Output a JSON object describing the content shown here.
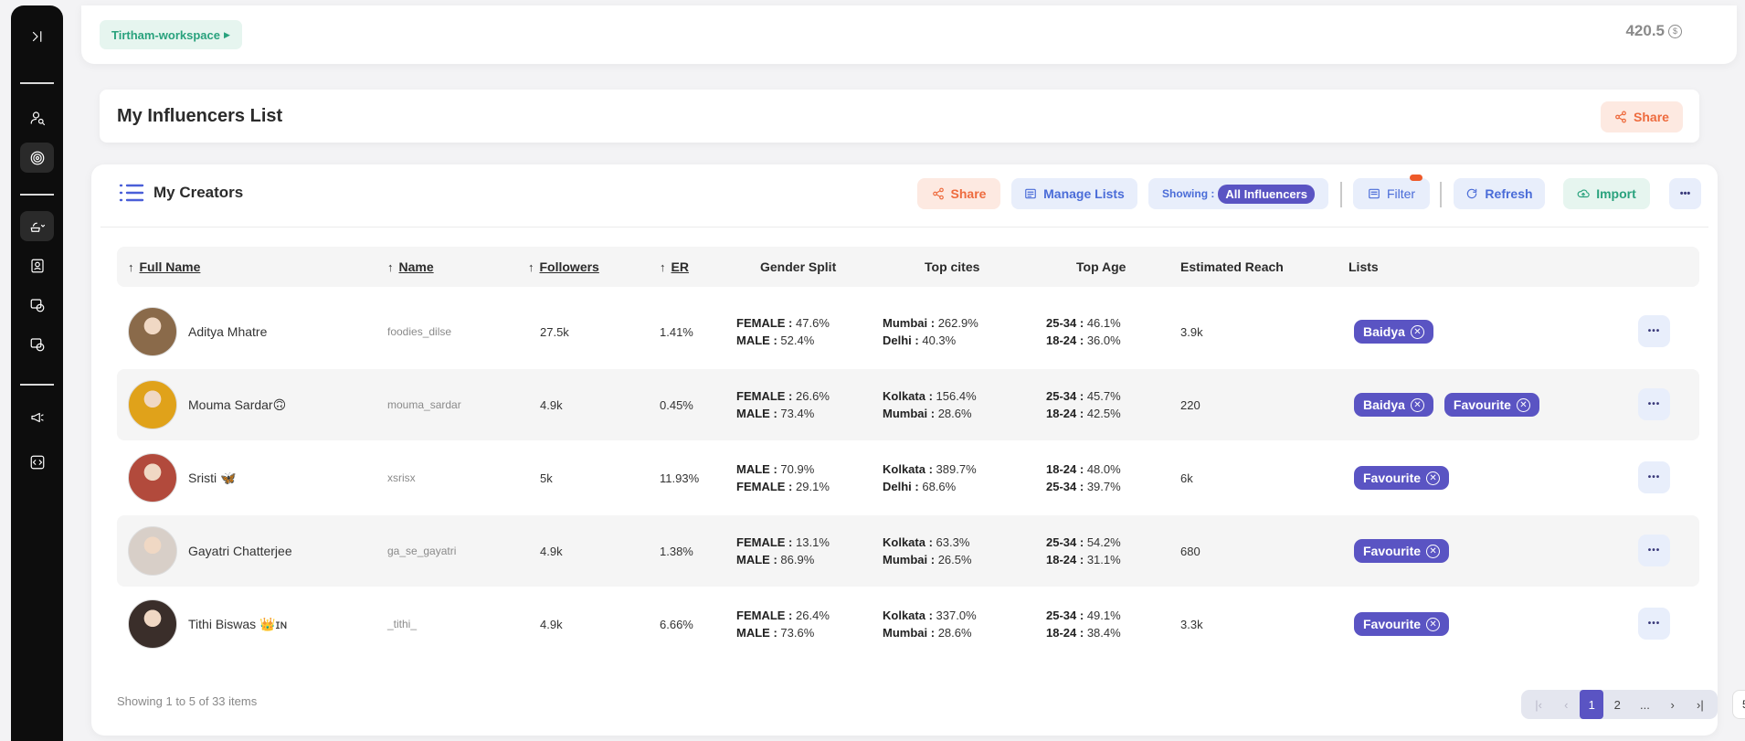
{
  "topbar": {
    "workspace": "Tirtham-workspace",
    "credits": "420.5",
    "credit_symbol": "$"
  },
  "header": {
    "title": "My Influencers List",
    "share_label": "Share"
  },
  "toolbar": {
    "title": "My Creators",
    "share_label": "Share",
    "manage_lists_label": "Manage Lists",
    "showing_label": "Showing :",
    "showing_value": "All Influencers",
    "filter_label": "Filter",
    "refresh_label": "Refresh",
    "import_label": "Import",
    "more_label": "•••"
  },
  "columns": {
    "full_name": "Full Name",
    "name": "Name",
    "followers": "Followers",
    "er": "ER",
    "gender_split": "Gender Split",
    "top_cites": "Top cites",
    "top_age": "Top Age",
    "estimated_reach": "Estimated Reach",
    "lists": "Lists"
  },
  "rows": [
    {
      "full_name": "Aditya Mhatre",
      "username": "foodies_dilse",
      "followers": "27.5k",
      "er": "1.41%",
      "g1k": "FEMALE :",
      "g1v": "47.6%",
      "g2k": "MALE :",
      "g2v": "52.4%",
      "c1k": "Mumbai :",
      "c1v": "262.9%",
      "c2k": "Delhi :",
      "c2v": "40.3%",
      "a1k": "25-34 :",
      "a1v": "46.1%",
      "a2k": "18-24 :",
      "a2v": "36.0%",
      "reach": "3.9k",
      "lists": [
        "Baidya"
      ],
      "avatar_color": "#8a6a4a"
    },
    {
      "full_name": "Mouma Sardar🙃",
      "username": "mouma_sardar",
      "followers": "4.9k",
      "er": "0.45%",
      "g1k": "FEMALE :",
      "g1v": "26.6%",
      "g2k": "MALE :",
      "g2v": "73.4%",
      "c1k": "Kolkata :",
      "c1v": "156.4%",
      "c2k": "Mumbai :",
      "c2v": "28.6%",
      "a1k": "25-34 :",
      "a1v": "45.7%",
      "a2k": "18-24 :",
      "a2v": "42.5%",
      "reach": "220",
      "lists": [
        "Baidya",
        "Favourite"
      ],
      "avatar_color": "#e0a21a"
    },
    {
      "full_name": "Sristi 🦋",
      "username": "xsrisx",
      "followers": "5k",
      "er": "11.93%",
      "g1k": "MALE :",
      "g1v": "70.9%",
      "g2k": "FEMALE :",
      "g2v": "29.1%",
      "c1k": "Kolkata :",
      "c1v": "389.7%",
      "c2k": "Delhi :",
      "c2v": "68.6%",
      "a1k": "18-24 :",
      "a1v": "48.0%",
      "a2k": "25-34 :",
      "a2v": "39.7%",
      "reach": "6k",
      "lists": [
        "Favourite"
      ],
      "avatar_color": "#b24a3c"
    },
    {
      "full_name": "Gayatri Chatterjee",
      "username": "ga_se_gayatri",
      "followers": "4.9k",
      "er": "1.38%",
      "g1k": "FEMALE :",
      "g1v": "13.1%",
      "g2k": "MALE :",
      "g2v": "86.9%",
      "c1k": "Kolkata :",
      "c1v": "63.3%",
      "c2k": "Mumbai :",
      "c2v": "26.5%",
      "a1k": "25-34 :",
      "a1v": "54.2%",
      "a2k": "18-24 :",
      "a2v": "31.1%",
      "reach": "680",
      "lists": [
        "Favourite"
      ],
      "avatar_color": "#d8cfc8"
    },
    {
      "full_name": "Tithi Biswas 👑ɪɴ",
      "username": "_tithi_",
      "followers": "4.9k",
      "er": "6.66%",
      "g1k": "FEMALE :",
      "g1v": "26.4%",
      "g2k": "MALE :",
      "g2v": "73.6%",
      "c1k": "Kolkata :",
      "c1v": "337.0%",
      "c2k": "Mumbai :",
      "c2v": "28.6%",
      "a1k": "25-34 :",
      "a1v": "49.1%",
      "a2k": "18-24 :",
      "a2v": "38.4%",
      "reach": "3.3k",
      "lists": [
        "Favourite"
      ],
      "avatar_color": "#3a2e2a"
    }
  ],
  "footer": {
    "summary": "Showing 1 to 5 of 33 items",
    "pages": [
      "1",
      "2",
      "..."
    ],
    "page_size": "5"
  },
  "colors": {
    "accent": "#5a54c3",
    "orange": "#ee6b3e",
    "green": "#29a27d",
    "blue": "#4a6cd8"
  }
}
